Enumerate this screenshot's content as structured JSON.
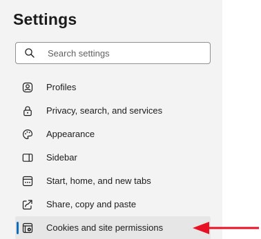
{
  "header": {
    "title": "Settings"
  },
  "search": {
    "placeholder": "Search settings"
  },
  "sidebar": {
    "items": [
      {
        "label": "Profiles",
        "icon": "profile-icon"
      },
      {
        "label": "Privacy, search, and services",
        "icon": "lock-icon"
      },
      {
        "label": "Appearance",
        "icon": "palette-icon"
      },
      {
        "label": "Sidebar",
        "icon": "sidebar-icon"
      },
      {
        "label": "Start, home, and new tabs",
        "icon": "home-tabs-icon"
      },
      {
        "label": "Share, copy and paste",
        "icon": "share-icon"
      },
      {
        "label": "Cookies and site permissions",
        "icon": "cookies-settings-icon",
        "selected": true
      }
    ]
  },
  "annotation": {
    "arrow_color": "#e81123",
    "accent_color": "#0f6cbd"
  }
}
